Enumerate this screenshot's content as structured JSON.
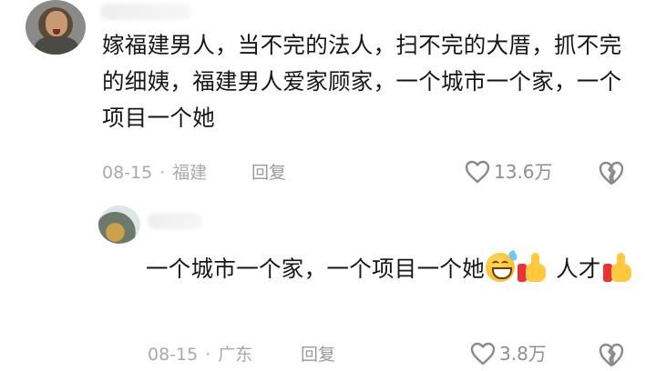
{
  "comment": {
    "text": "嫁福建男人，当不完的法人，扫不完的大厝，抓不完的细姨，福建男人爱家顾家，一个城市一个家，一个项目一个她",
    "date": "08-15",
    "separator": "·",
    "location": "福建",
    "reply_label": "回复",
    "like_count": "13.6万"
  },
  "reply": {
    "text_part1": "一个城市一个家，一个项目一个她",
    "text_part2": " 人才",
    "date": "08-15",
    "separator": "·",
    "location": "广东",
    "reply_label": "回复",
    "like_count": "3.8万"
  },
  "icons": {
    "like": "heart-outline-icon",
    "dislike": "broken-heart-icon",
    "emoji_laugh": "grinning-sweat-emoji",
    "emoji_thumb": "thumbs-up-emoji"
  }
}
